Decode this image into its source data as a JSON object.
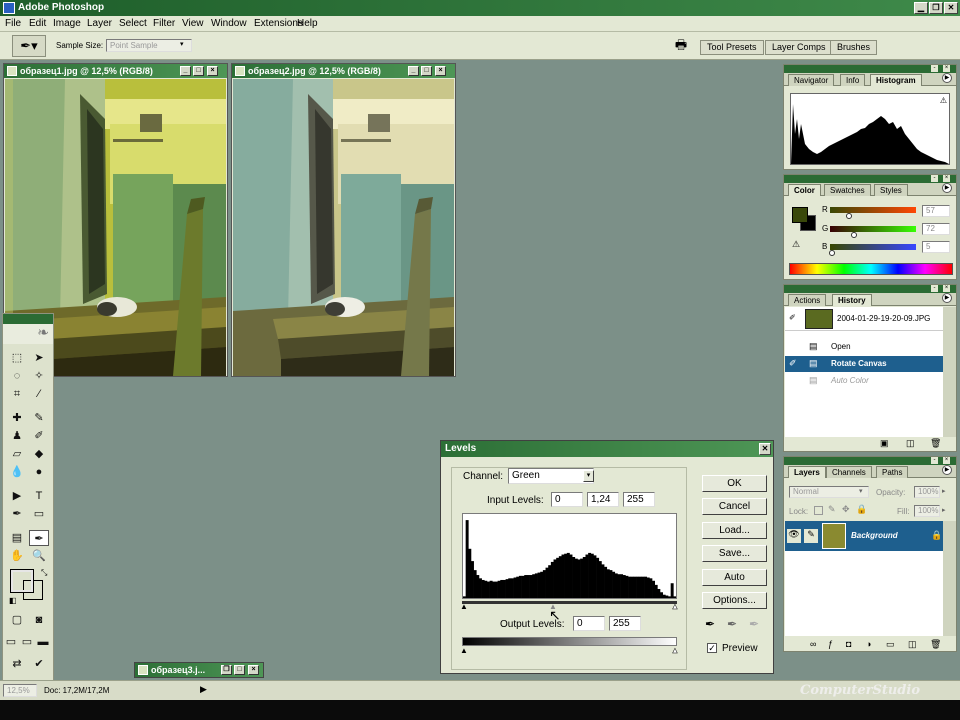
{
  "app": {
    "title": "Adobe Photoshop"
  },
  "menu": [
    "File",
    "Edit",
    "Image",
    "Layer",
    "Select",
    "Filter",
    "View",
    "Window",
    "Extensions",
    "Help"
  ],
  "options": {
    "sample_size_label": "Sample Size:",
    "sample_size_value": "Point Sample"
  },
  "palette_well": [
    "Tool Presets",
    "Layer Comps",
    "Brushes"
  ],
  "documents": {
    "doc1_title": "образец1.jpg @ 12,5% (RGB/8)",
    "doc2_title": "образец2.jpg @ 12,5% (RGB/8)",
    "doc3_title": "образец3.j..."
  },
  "navigator_panel": {
    "tabs": [
      "Navigator",
      "Info",
      "Histogram"
    ]
  },
  "color_panel": {
    "tabs": [
      "Color",
      "Swatches",
      "Styles"
    ],
    "r_label": "R",
    "g_label": "G",
    "b_label": "B",
    "r_value": "57",
    "g_value": "72",
    "b_value": "5",
    "r_slider": 0.22,
    "g_slider": 0.28,
    "b_slider": 0.02
  },
  "history_panel": {
    "tabs": [
      "Actions",
      "History"
    ],
    "snapshot": "2004-01-29-19-20-09.JPG",
    "items": [
      "Open",
      "Rotate Canvas",
      "Auto Color"
    ]
  },
  "layers_panel": {
    "tabs": [
      "Layers",
      "Channels",
      "Paths"
    ],
    "blend_mode": "Normal",
    "opacity_label": "Opacity:",
    "opacity_value": "100%",
    "lock_label": "Lock:",
    "fill_label": "Fill:",
    "fill_value": "100%",
    "layer_name": "Background"
  },
  "levels_dialog": {
    "title": "Levels",
    "channel_label": "Channel:",
    "channel_value": "Green",
    "input_levels_label": "Input Levels:",
    "input_black": "0",
    "input_gamma": "1,24",
    "input_white": "255",
    "output_levels_label": "Output Levels:",
    "output_black": "0",
    "output_white": "255",
    "buttons": {
      "ok": "OK",
      "cancel": "Cancel",
      "load": "Load...",
      "save": "Save...",
      "auto": "Auto",
      "options": "Options..."
    },
    "preview_label": "Preview",
    "preview_checked": true,
    "histogram": [
      2,
      95,
      60,
      45,
      34,
      28,
      24,
      22,
      21,
      20,
      21,
      20,
      20,
      21,
      22,
      22,
      23,
      24,
      24,
      25,
      26,
      27,
      27,
      28,
      28,
      28,
      29,
      30,
      31,
      32,
      34,
      37,
      40,
      44,
      47,
      49,
      51,
      53,
      54,
      55,
      53,
      50,
      48,
      47,
      48,
      50,
      53,
      55,
      54,
      52,
      49,
      45,
      41,
      38,
      35,
      34,
      32,
      30,
      29,
      29,
      28,
      27,
      26,
      26,
      26,
      26,
      26,
      26,
      26,
      25,
      24,
      21,
      16,
      11,
      7,
      4,
      3,
      2,
      18,
      2
    ]
  },
  "status": {
    "zoom": "12,5%",
    "doc_info": "Doc: 17,2M/17,2M",
    "watermark": "ComputerStudio"
  },
  "colors": {
    "foreground": "#39480a",
    "background": "#000000",
    "accent": "#2b6b34"
  }
}
